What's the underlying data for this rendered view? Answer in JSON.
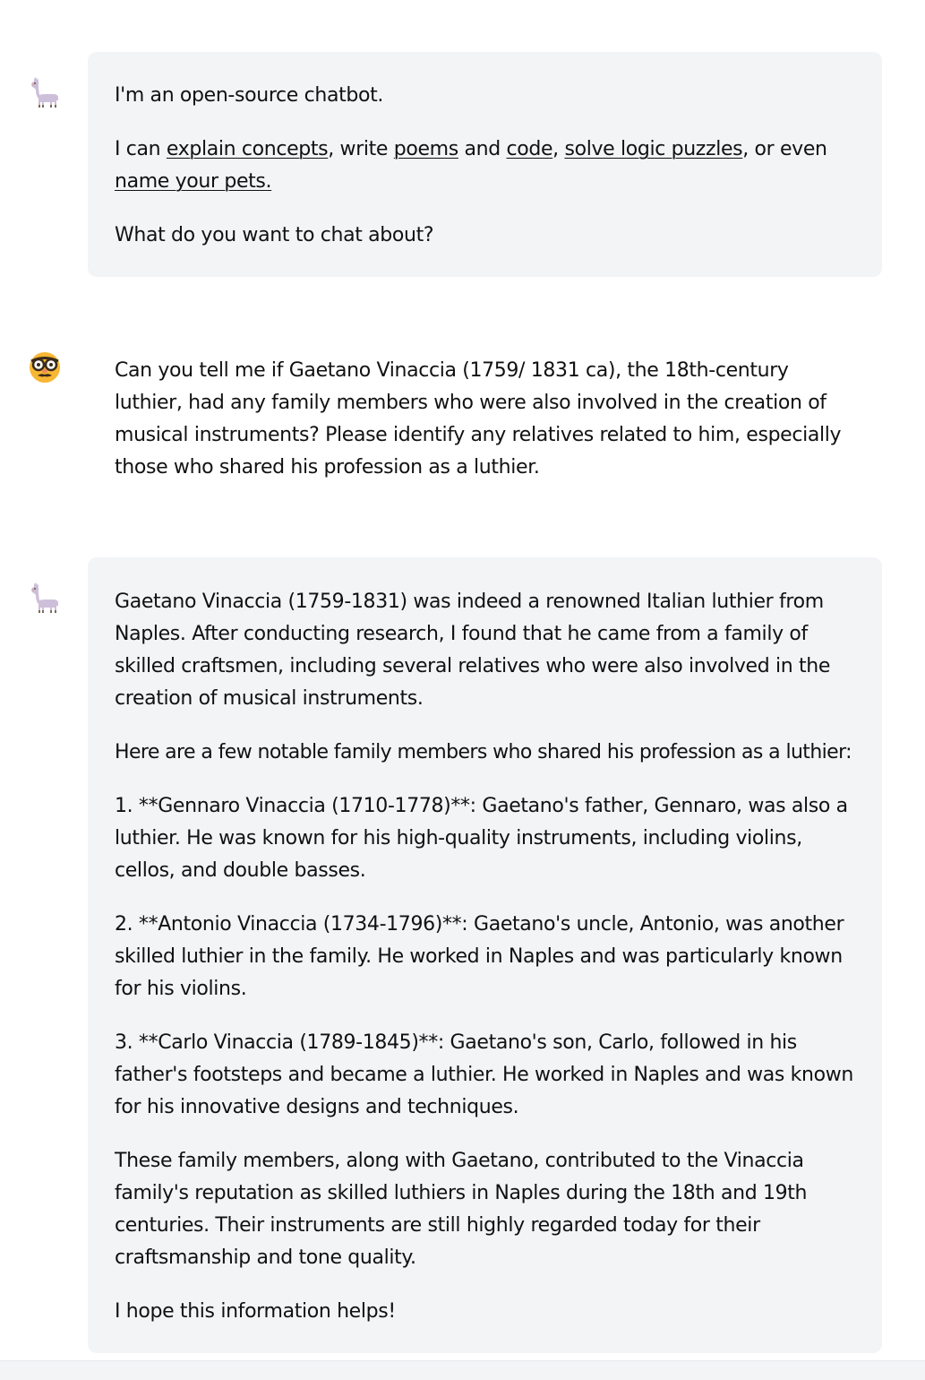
{
  "intro": {
    "line1": "I'm an open-source chatbot.",
    "line2_prefix": "I can ",
    "link_explain": "explain concepts",
    "sep1": ", write ",
    "link_poems": "poems",
    "sep2": " and ",
    "link_code": "code",
    "sep3": ", ",
    "link_logic": "solve logic puzzles",
    "sep4": ", or even ",
    "link_pets": "name your pets.",
    "line3": "What do you want to chat about?"
  },
  "user_message": {
    "text": "Can you tell me if Gaetano Vinaccia (1759/ 1831 ca), the 18th-century luthier, had any family members who were also involved in the creation of musical instruments? Please identify any relatives related to him, especially those who shared his profession as a luthier."
  },
  "bot_reply": {
    "paragraphs": [
      "Gaetano Vinaccia (1759-1831) was indeed a renowned Italian luthier from Naples. After conducting research, I found that he came from a family of skilled craftsmen, including several relatives who were also involved in the creation of musical instruments.",
      "Here are a few notable family members who shared his profession as a luthier:",
      "1. **Gennaro Vinaccia (1710-1778)**: Gaetano's father, Gennaro, was also a luthier. He was known for his high-quality instruments, including violins, cellos, and double basses.",
      "2. **Antonio Vinaccia (1734-1796)**: Gaetano's uncle, Antonio, was another skilled luthier in the family. He worked in Naples and was particularly known for his violins.",
      "3. **Carlo Vinaccia (1789-1845)**: Gaetano's son, Carlo, followed in his father's footsteps and became a luthier. He worked in Naples and was known for his innovative designs and techniques.",
      "These family members, along with Gaetano, contributed to the Vinaccia family's reputation as skilled luthiers in Naples during the 18th and 19th centuries. Their instruments are still highly regarded today for their craftsmanship and tone quality.",
      "I hope this information helps!"
    ]
  },
  "icons": {
    "bot_avatar": "llama-icon",
    "user_avatar": "disguise-glasses-face-icon"
  },
  "colors": {
    "bot_bubble_bg": "#f3f4f6",
    "text": "#111111",
    "page_bg": "#ffffff"
  }
}
